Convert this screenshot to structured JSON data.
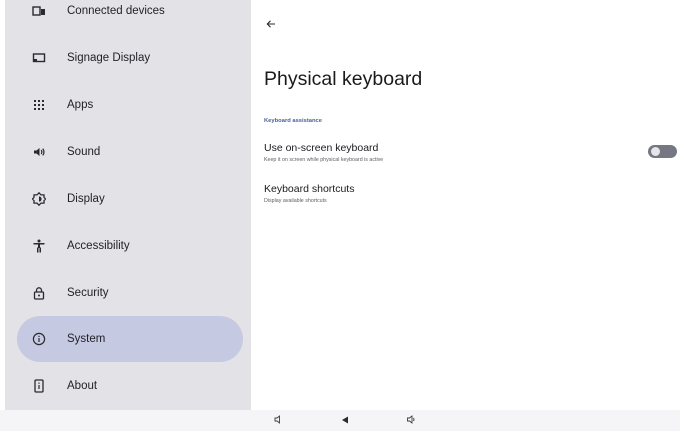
{
  "sidebar": {
    "items": [
      {
        "label": "Connected devices",
        "icon": "connected-devices-icon"
      },
      {
        "label": "Signage Display",
        "icon": "signage-display-icon"
      },
      {
        "label": "Apps",
        "icon": "apps-grid-icon"
      },
      {
        "label": "Sound",
        "icon": "volume-icon"
      },
      {
        "label": "Display",
        "icon": "brightness-icon"
      },
      {
        "label": "Accessibility",
        "icon": "accessibility-icon"
      },
      {
        "label": "Security",
        "icon": "lock-icon"
      },
      {
        "label": "System",
        "icon": "info-icon",
        "selected": true
      },
      {
        "label": "About",
        "icon": "tablet-info-icon"
      }
    ]
  },
  "detail": {
    "title": "Physical keyboard",
    "section_header": "Keyboard assistance",
    "preferences": [
      {
        "title": "Use on-screen keyboard",
        "summary": "Keep it on screen while physical keyboard is active",
        "toggle_on": false
      },
      {
        "title": "Keyboard shortcuts",
        "summary": "Display available shortcuts"
      }
    ]
  },
  "colors": {
    "sidebar_bg": "#e3e2e6",
    "selected_bg": "#c6c9e2",
    "section_header": "#47609a",
    "toggle_track_off": "#757782"
  }
}
